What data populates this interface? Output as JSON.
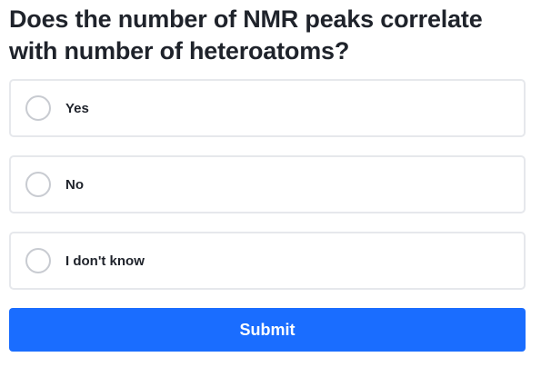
{
  "question": {
    "text": "Does the number of NMR peaks correlate with number of heteroatoms?"
  },
  "options": [
    {
      "label": "Yes",
      "selected": false
    },
    {
      "label": "No",
      "selected": false
    },
    {
      "label": "I don't know",
      "selected": false
    }
  ],
  "submit": {
    "label": "Submit",
    "color": "#1a6dff"
  }
}
